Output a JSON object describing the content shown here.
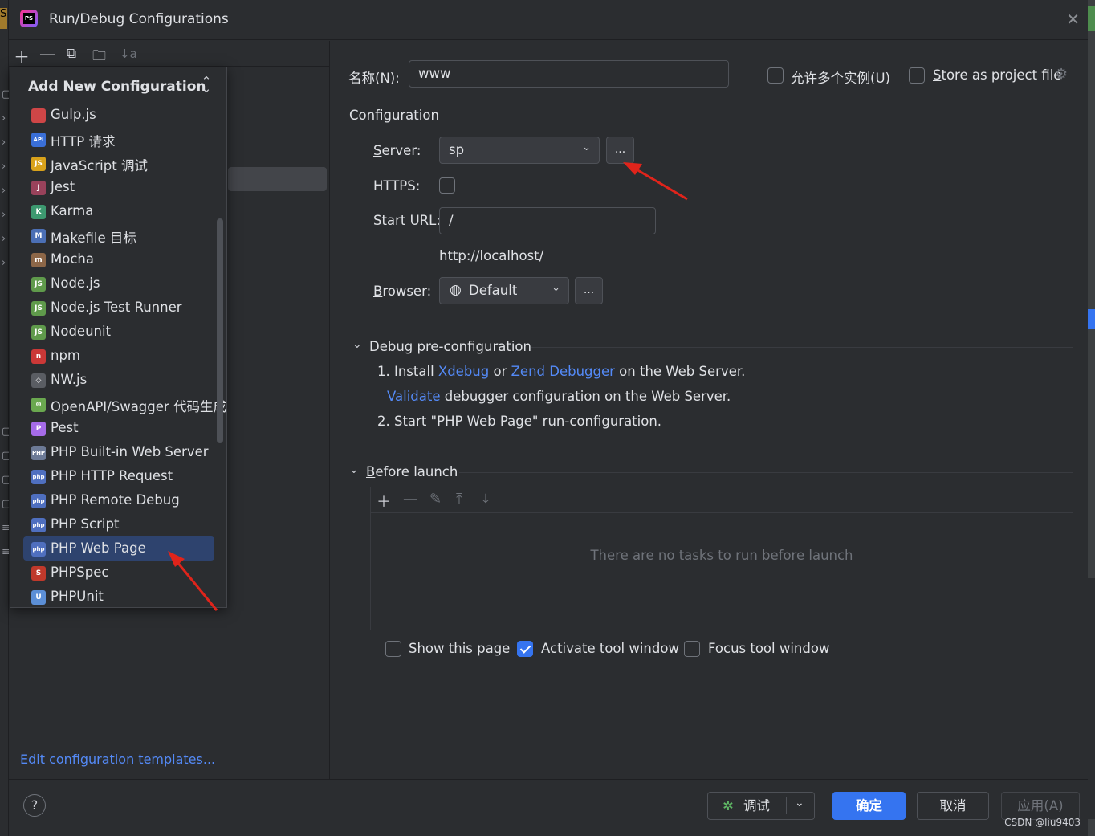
{
  "window": {
    "title": "Run/Debug Configurations",
    "logo_text": "PS"
  },
  "toolbar": {
    "icons": [
      "plus-icon",
      "minus-icon",
      "copy-icon",
      "folder-add-icon",
      "sort-icon"
    ]
  },
  "popup": {
    "title": "Add New Configuration",
    "items": [
      {
        "label": "Gulp.js",
        "icon": "gulp-icon",
        "icon_text": "",
        "color": "#cf4647"
      },
      {
        "label": "HTTP 请求",
        "icon": "http-api-icon",
        "icon_text": "API",
        "color": "#3a6fd8"
      },
      {
        "label": "JavaScript 调试",
        "icon": "javascript-icon",
        "icon_text": "JS",
        "color": "#d9a21b"
      },
      {
        "label": "Jest",
        "icon": "jest-icon",
        "icon_text": "J",
        "color": "#99425b"
      },
      {
        "label": "Karma",
        "icon": "karma-icon",
        "icon_text": "K",
        "color": "#3d9970"
      },
      {
        "label": "Makefile 目标",
        "icon": "makefile-icon",
        "icon_text": "M",
        "color": "#4b6fb5"
      },
      {
        "label": "Mocha",
        "icon": "mocha-icon",
        "icon_text": "m",
        "color": "#8d6748"
      },
      {
        "label": "Node.js",
        "icon": "nodejs-icon",
        "icon_text": "JS",
        "color": "#5f9a4b"
      },
      {
        "label": "Node.js Test Runner",
        "icon": "nodejs-test-icon",
        "icon_text": "JS",
        "color": "#5f9a4b"
      },
      {
        "label": "Nodeunit",
        "icon": "nodeunit-icon",
        "icon_text": "JS",
        "color": "#5f9a4b"
      },
      {
        "label": "npm",
        "icon": "npm-icon",
        "icon_text": "n",
        "color": "#cb3837"
      },
      {
        "label": "NW.js",
        "icon": "nwjs-icon",
        "icon_text": "◇",
        "color": "#5a5d63"
      },
      {
        "label": "OpenAPI/Swagger 代码生成",
        "icon": "openapi-icon",
        "icon_text": "⊕",
        "color": "#6aa84f"
      },
      {
        "label": "Pest",
        "icon": "pest-icon",
        "icon_text": "P",
        "color": "#a56be8"
      },
      {
        "label": "PHP Built-in Web Server",
        "icon": "php-builtin-server-icon",
        "icon_text": "PHP",
        "color": "#6c7a96"
      },
      {
        "label": "PHP HTTP Request",
        "icon": "php-http-request-icon",
        "icon_text": "php",
        "color": "#4f6fbf"
      },
      {
        "label": "PHP Remote Debug",
        "icon": "php-remote-debug-icon",
        "icon_text": "php",
        "color": "#4f6fbf"
      },
      {
        "label": "PHP Script",
        "icon": "php-script-icon",
        "icon_text": "php",
        "color": "#4f6fbf"
      },
      {
        "label": "PHP Web Page",
        "icon": "php-web-page-icon",
        "icon_text": "php",
        "color": "#4f6fbf"
      },
      {
        "label": "PHPSpec",
        "icon": "phpspec-icon",
        "icon_text": "S",
        "color": "#c0392b"
      },
      {
        "label": "PHPUnit",
        "icon": "phpunit-icon",
        "icon_text": "U",
        "color": "#5c8fd6"
      }
    ],
    "selected_index": 18
  },
  "edit_templates": "Edit configuration templates...",
  "form": {
    "name_label": "名称(",
    "name_mnemonic": "N",
    "name_label_end": "):",
    "name_value": "www",
    "allow_multiple_label": "允许多个实例(",
    "allow_multiple_mnemonic": "U",
    "allow_multiple_end": ")",
    "store_project_label": "tore as project file",
    "store_project_mnemonic": "S",
    "configuration_title": "Configuration",
    "server_label_mn": "S",
    "server_label_rest": "erver:",
    "server_value": "sp",
    "https_label": "HTTPS:",
    "start_url_label": "Start ",
    "start_url_mn": "U",
    "start_url_end": "RL:",
    "start_url_value": "/",
    "resolved_url": "http://localhost/",
    "browser_label_mn": "B",
    "browser_label_rest": "rowser:",
    "browser_value": "Default",
    "dots": "..."
  },
  "debug_pre": {
    "title": "Debug pre-configuration",
    "line1_prefix": "1. Install ",
    "line1_link1": "Xdebug",
    "line1_mid": " or ",
    "line1_link2": "Zend Debugger",
    "line1_suffix": " on the Web Server.",
    "line2_link": "Validate",
    "line2_suffix": " debugger configuration on the Web Server.",
    "line3": "2. Start \"PHP Web Page\" run-configuration."
  },
  "before_launch": {
    "title_mn": "B",
    "title_rest": "efore launch",
    "empty_text": "There are no tasks to run before launch",
    "show_page": "Show this page",
    "show_page_checked": false,
    "activate_tool": "Activate tool window",
    "activate_tool_checked": true,
    "focus_tool": "Focus tool window",
    "focus_tool_checked": false
  },
  "footer": {
    "help": "?",
    "debug_button": "调试",
    "ok_button": "确定",
    "cancel_button": "取消",
    "apply_button": "应用(A)"
  },
  "watermark": "CSDN @liu9403"
}
